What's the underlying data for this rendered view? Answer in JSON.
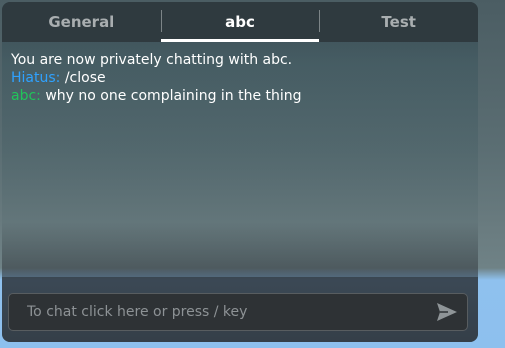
{
  "tabs": [
    {
      "label": "General",
      "active": false
    },
    {
      "label": "abc",
      "active": true
    },
    {
      "label": "Test",
      "active": false
    }
  ],
  "messages": [
    {
      "sender": "",
      "text": "You are now privately chatting with abc."
    },
    {
      "sender": "Hiatus:",
      "text": " /close",
      "sender_color": "#2fa2ff"
    },
    {
      "sender": "abc:",
      "text": " why no one complaining in the thing",
      "sender_color": "#20c55a"
    }
  ],
  "input": {
    "placeholder": "To chat click here or press / key",
    "value": ""
  },
  "send_button": {
    "icon": "send-arrow-icon"
  },
  "colors": {
    "tab_bar": "#2f3a3f",
    "active_tab_text": "#ffffff",
    "inactive_tab_text": "#a9aeb0",
    "hiatus_sender": "#2fa2ff",
    "abc_sender": "#20c55a",
    "input_box": "#2e3235"
  }
}
